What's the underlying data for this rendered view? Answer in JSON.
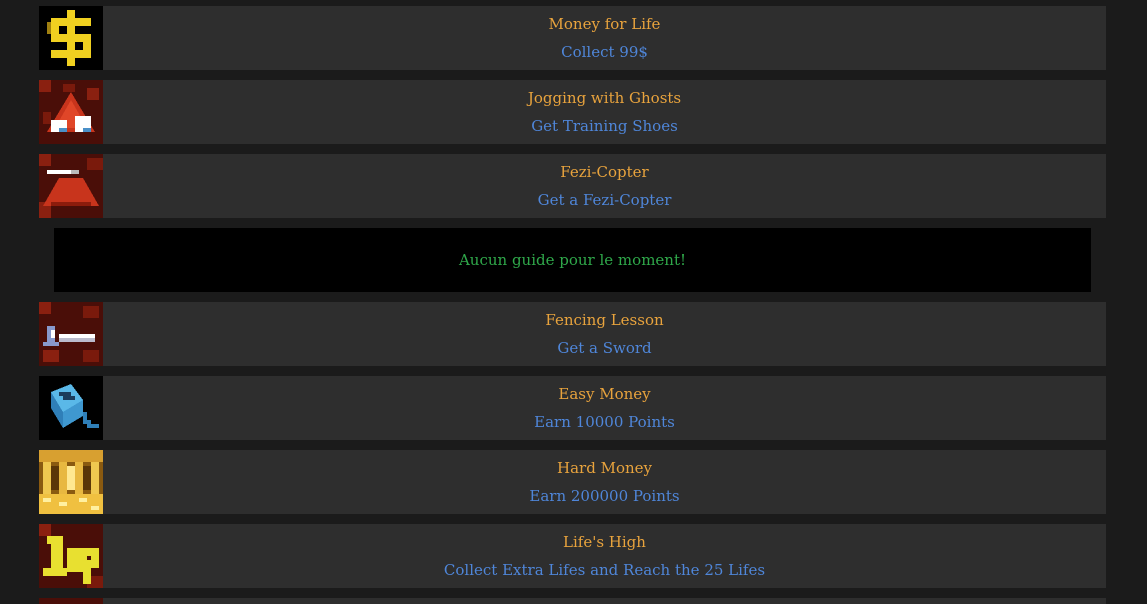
{
  "colors": {
    "background": "#1b1b1b",
    "row": "#2e2e2e",
    "title": "#e8a33d",
    "description": "#4f86d9",
    "guide_background": "#000000",
    "guide_text": "#2fa84a"
  },
  "achievements": [
    {
      "icon": "dollar-icon",
      "title": "Money for Life",
      "description": "Collect 99$"
    },
    {
      "icon": "ghost-shoes-icon",
      "title": "Jogging with Ghosts",
      "description": "Get Training Shoes"
    },
    {
      "icon": "fezi-copter-icon",
      "title": "Fezi-Copter",
      "description": "Get a Fezi-Copter"
    },
    {
      "icon": "sword-icon",
      "title": "Fencing Lesson",
      "description": "Get a Sword"
    },
    {
      "icon": "toaster-icon",
      "title": "Easy Money",
      "description": "Earn 10000 Points"
    },
    {
      "icon": "treasure-hall-icon",
      "title": "Hard Money",
      "description": "Earn 200000 Points"
    },
    {
      "icon": "one-up-icon",
      "title": "Life's High",
      "description": "Collect Extra Lifes and Reach the 25 Lifes"
    }
  ],
  "guide": {
    "message": "Aucun guide pour le moment!"
  }
}
